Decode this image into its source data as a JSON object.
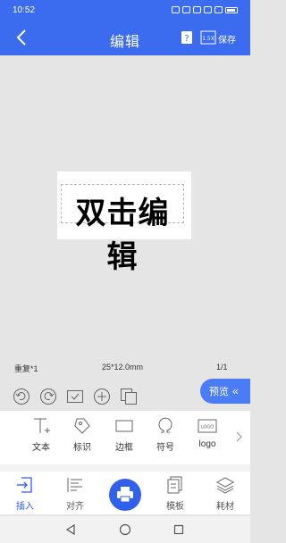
{
  "status": {
    "time": "10:52"
  },
  "header": {
    "title": "编辑",
    "save_label": "保存",
    "scale_badge": "1.5X"
  },
  "label": {
    "text": "双击编辑"
  },
  "info": {
    "repeat": "重复*1",
    "size": "25*12.0mm",
    "page": "1/1"
  },
  "preview": {
    "label": "预览",
    "chevron": "«"
  },
  "insert_items": [
    {
      "label": "文本",
      "icon": "text-icon"
    },
    {
      "label": "标识",
      "icon": "tag-icon"
    },
    {
      "label": "边框",
      "icon": "border-icon"
    },
    {
      "label": "符号",
      "icon": "omega-icon"
    },
    {
      "label": "logo",
      "icon": "logo-icon",
      "badge": "LOGO"
    }
  ],
  "tabs": [
    {
      "label": "插入",
      "icon": "insert-icon",
      "active": true
    },
    {
      "label": "对齐",
      "icon": "align-icon"
    },
    {
      "label": "模板",
      "icon": "template-icon"
    },
    {
      "label": "耗材",
      "icon": "layers-icon"
    }
  ],
  "colors": {
    "primary": "#3b6cf0",
    "active_tab": "#2d5cec",
    "fab": "#2f61ec"
  }
}
